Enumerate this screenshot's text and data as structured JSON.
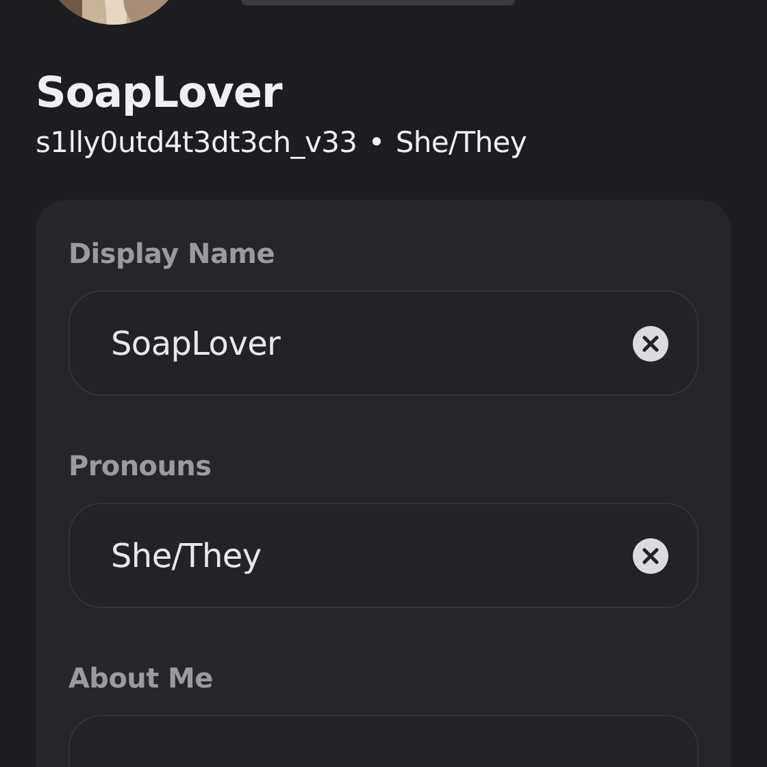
{
  "profile": {
    "display_name": "SoapLover",
    "username": "s1lly0utd4t3dt3ch_v33",
    "separator": "•",
    "pronouns": "She/They"
  },
  "fields": [
    {
      "label": "Display Name",
      "value": "SoapLover"
    },
    {
      "label": "Pronouns",
      "value": "She/They"
    },
    {
      "label": "About Me"
    }
  ]
}
